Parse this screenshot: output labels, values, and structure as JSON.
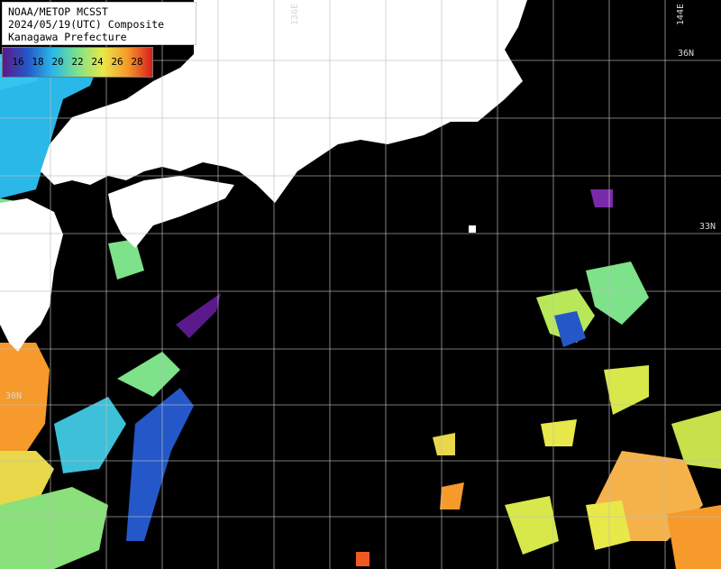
{
  "title": {
    "line1": "NOAA/METOP MCSST",
    "line2": "2024/05/19(UTC) Composite",
    "line3": "Kanagawa Prefecture"
  },
  "scale": {
    "labels": [
      "16",
      "18",
      "20",
      "22",
      "24",
      "26",
      "28"
    ],
    "colors": [
      "#5a1a8c",
      "#2457c8",
      "#2ab8e8",
      "#7de28a",
      "#e8e84a",
      "#f59a2b",
      "#d81e1e"
    ]
  },
  "lat_labels": [
    "36N",
    "33N",
    "30N"
  ],
  "lon_labels": [
    "136E",
    "144E"
  ],
  "colors": {
    "land": "#ffffff",
    "ocean_no_data": "#000000",
    "grid": "#bfbfbf"
  }
}
